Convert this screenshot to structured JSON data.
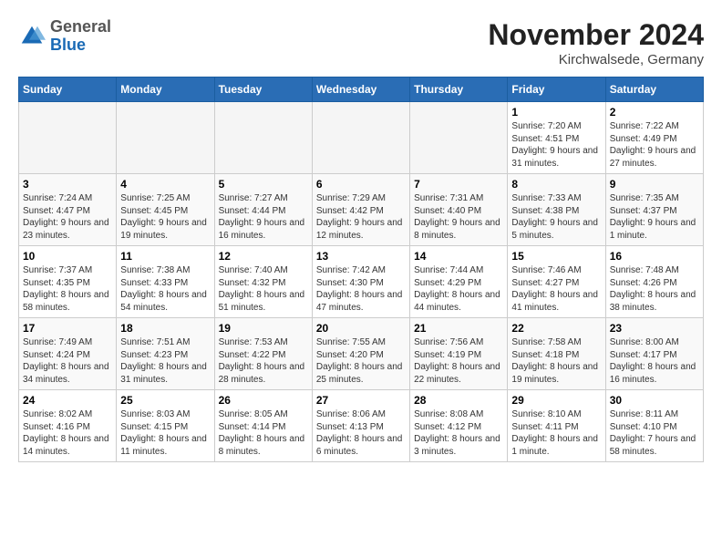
{
  "header": {
    "logo": {
      "general": "General",
      "blue": "Blue"
    },
    "title": "November 2024",
    "subtitle": "Kirchwalsede, Germany"
  },
  "calendar": {
    "days_of_week": [
      "Sunday",
      "Monday",
      "Tuesday",
      "Wednesday",
      "Thursday",
      "Friday",
      "Saturday"
    ],
    "weeks": [
      [
        {
          "day": "",
          "info": ""
        },
        {
          "day": "",
          "info": ""
        },
        {
          "day": "",
          "info": ""
        },
        {
          "day": "",
          "info": ""
        },
        {
          "day": "",
          "info": ""
        },
        {
          "day": "1",
          "info": "Sunrise: 7:20 AM\nSunset: 4:51 PM\nDaylight: 9 hours and 31 minutes."
        },
        {
          "day": "2",
          "info": "Sunrise: 7:22 AM\nSunset: 4:49 PM\nDaylight: 9 hours and 27 minutes."
        }
      ],
      [
        {
          "day": "3",
          "info": "Sunrise: 7:24 AM\nSunset: 4:47 PM\nDaylight: 9 hours and 23 minutes."
        },
        {
          "day": "4",
          "info": "Sunrise: 7:25 AM\nSunset: 4:45 PM\nDaylight: 9 hours and 19 minutes."
        },
        {
          "day": "5",
          "info": "Sunrise: 7:27 AM\nSunset: 4:44 PM\nDaylight: 9 hours and 16 minutes."
        },
        {
          "day": "6",
          "info": "Sunrise: 7:29 AM\nSunset: 4:42 PM\nDaylight: 9 hours and 12 minutes."
        },
        {
          "day": "7",
          "info": "Sunrise: 7:31 AM\nSunset: 4:40 PM\nDaylight: 9 hours and 8 minutes."
        },
        {
          "day": "8",
          "info": "Sunrise: 7:33 AM\nSunset: 4:38 PM\nDaylight: 9 hours and 5 minutes."
        },
        {
          "day": "9",
          "info": "Sunrise: 7:35 AM\nSunset: 4:37 PM\nDaylight: 9 hours and 1 minute."
        }
      ],
      [
        {
          "day": "10",
          "info": "Sunrise: 7:37 AM\nSunset: 4:35 PM\nDaylight: 8 hours and 58 minutes."
        },
        {
          "day": "11",
          "info": "Sunrise: 7:38 AM\nSunset: 4:33 PM\nDaylight: 8 hours and 54 minutes."
        },
        {
          "day": "12",
          "info": "Sunrise: 7:40 AM\nSunset: 4:32 PM\nDaylight: 8 hours and 51 minutes."
        },
        {
          "day": "13",
          "info": "Sunrise: 7:42 AM\nSunset: 4:30 PM\nDaylight: 8 hours and 47 minutes."
        },
        {
          "day": "14",
          "info": "Sunrise: 7:44 AM\nSunset: 4:29 PM\nDaylight: 8 hours and 44 minutes."
        },
        {
          "day": "15",
          "info": "Sunrise: 7:46 AM\nSunset: 4:27 PM\nDaylight: 8 hours and 41 minutes."
        },
        {
          "day": "16",
          "info": "Sunrise: 7:48 AM\nSunset: 4:26 PM\nDaylight: 8 hours and 38 minutes."
        }
      ],
      [
        {
          "day": "17",
          "info": "Sunrise: 7:49 AM\nSunset: 4:24 PM\nDaylight: 8 hours and 34 minutes."
        },
        {
          "day": "18",
          "info": "Sunrise: 7:51 AM\nSunset: 4:23 PM\nDaylight: 8 hours and 31 minutes."
        },
        {
          "day": "19",
          "info": "Sunrise: 7:53 AM\nSunset: 4:22 PM\nDaylight: 8 hours and 28 minutes."
        },
        {
          "day": "20",
          "info": "Sunrise: 7:55 AM\nSunset: 4:20 PM\nDaylight: 8 hours and 25 minutes."
        },
        {
          "day": "21",
          "info": "Sunrise: 7:56 AM\nSunset: 4:19 PM\nDaylight: 8 hours and 22 minutes."
        },
        {
          "day": "22",
          "info": "Sunrise: 7:58 AM\nSunset: 4:18 PM\nDaylight: 8 hours and 19 minutes."
        },
        {
          "day": "23",
          "info": "Sunrise: 8:00 AM\nSunset: 4:17 PM\nDaylight: 8 hours and 16 minutes."
        }
      ],
      [
        {
          "day": "24",
          "info": "Sunrise: 8:02 AM\nSunset: 4:16 PM\nDaylight: 8 hours and 14 minutes."
        },
        {
          "day": "25",
          "info": "Sunrise: 8:03 AM\nSunset: 4:15 PM\nDaylight: 8 hours and 11 minutes."
        },
        {
          "day": "26",
          "info": "Sunrise: 8:05 AM\nSunset: 4:14 PM\nDaylight: 8 hours and 8 minutes."
        },
        {
          "day": "27",
          "info": "Sunrise: 8:06 AM\nSunset: 4:13 PM\nDaylight: 8 hours and 6 minutes."
        },
        {
          "day": "28",
          "info": "Sunrise: 8:08 AM\nSunset: 4:12 PM\nDaylight: 8 hours and 3 minutes."
        },
        {
          "day": "29",
          "info": "Sunrise: 8:10 AM\nSunset: 4:11 PM\nDaylight: 8 hours and 1 minute."
        },
        {
          "day": "30",
          "info": "Sunrise: 8:11 AM\nSunset: 4:10 PM\nDaylight: 7 hours and 58 minutes."
        }
      ]
    ]
  }
}
